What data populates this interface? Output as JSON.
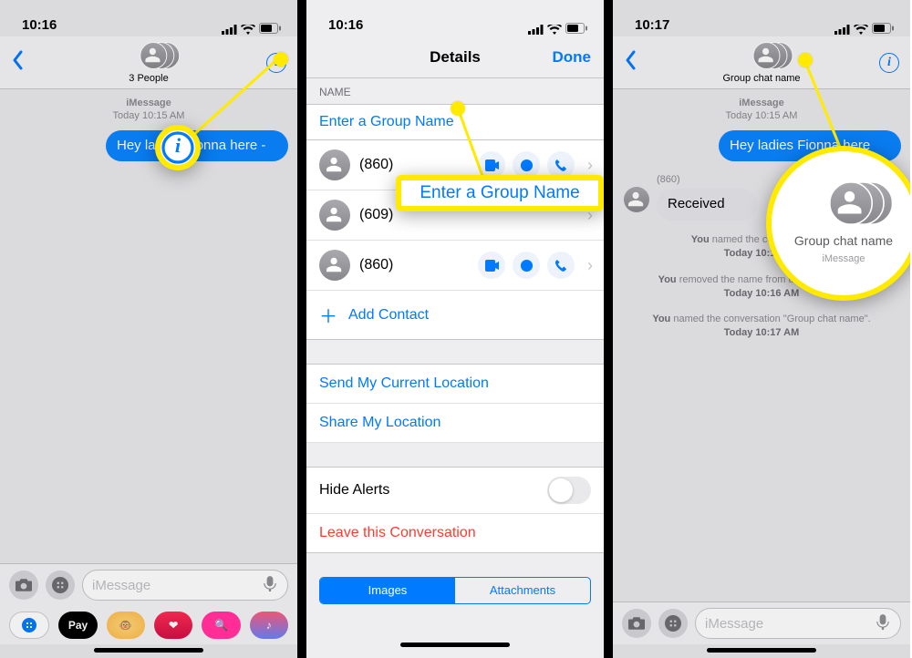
{
  "pane1": {
    "status": {
      "time": "10:16"
    },
    "nav": {
      "subtitle": "3 People"
    },
    "meta": {
      "line1": "iMessage",
      "line2": "Today 10:15 AM"
    },
    "bubble": "Hey ladies Fionna here -",
    "input": {
      "placeholder": "iMessage"
    },
    "apps": {
      "pay_label": " Pay"
    }
  },
  "pane2": {
    "status": {
      "time": "10:16"
    },
    "nav": {
      "title": "Details",
      "done": "Done"
    },
    "name_section": "NAME",
    "name_placeholder": "Enter a Group Name",
    "contacts": [
      {
        "num": "(860)"
      },
      {
        "num": "(609)"
      },
      {
        "num": "(860)"
      }
    ],
    "add_contact": "Add Contact",
    "send_loc": "Send My Current Location",
    "share_loc": "Share My Location",
    "hide_alerts": "Hide Alerts",
    "leave": "Leave this Conversation",
    "seg_images": "Images",
    "seg_attach": "Attachments",
    "callout_text": "Enter a Group Name"
  },
  "pane3": {
    "status": {
      "time": "10:17"
    },
    "nav": {
      "subtitle": "Group chat name"
    },
    "meta": {
      "line1": "iMessage",
      "line2": "Today 10:15 AM"
    },
    "bubble": "Hey ladies Fionna here",
    "sender": "(860)",
    "received": "Received",
    "sys1": {
      "prefix": "You",
      "middle": " named the conversation …",
      "time": "Today 10:16 AM"
    },
    "sys2": {
      "prefix": "You",
      "middle": " removed the name from the conversation.",
      "time": "Today 10:16 AM"
    },
    "sys3": {
      "prefix": "You",
      "middle": " named the conversation \"Group chat name\".",
      "time": "Today 10:17 AM"
    },
    "input": {
      "placeholder": "iMessage"
    },
    "mag": {
      "label": "Group chat name",
      "sub": "iMessage"
    }
  }
}
